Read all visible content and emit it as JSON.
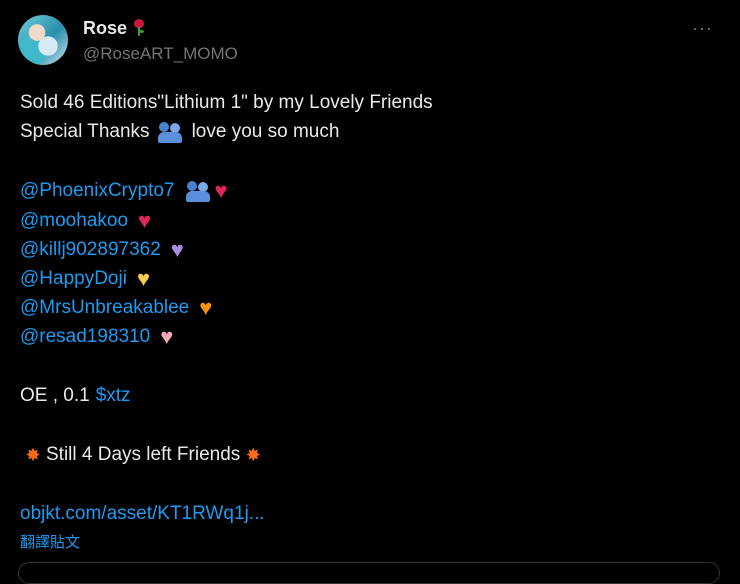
{
  "tweet": {
    "author_name": "Rose",
    "author_handle": "@RoseART_MOMO",
    "more_icon": "more-horizontal-icon",
    "line1": "Sold 46 Editions\"Lithium 1\" by my Lovely Friends",
    "line2_before": "Special Thanks",
    "line2_after": "love you so much",
    "mentions": [
      {
        "handle": "@PhoenixCrypto7",
        "icon": "people-hugging + sparkling-heart"
      },
      {
        "handle": "@moohakoo",
        "icon": "red-heart",
        "color": "#e0245e"
      },
      {
        "handle": "@killj902897362",
        "icon": "purple-heart",
        "color": "#a98ee6"
      },
      {
        "handle": "@HappyDoji",
        "icon": "yellow-heart",
        "color": "#ffcc4d"
      },
      {
        "handle": "@MrsUnbreakablee",
        "icon": "orange-heart",
        "color": "#f4900c"
      },
      {
        "handle": "@resad198310",
        "icon": "pink-heart",
        "color": "#f4a7b9"
      }
    ],
    "price_text": "OE , 0.1",
    "price_cashtag": "$xtz",
    "countdown": "Still 4 Days left Friends",
    "link": "objkt.com/asset/KT1RWq1j...",
    "translate_label": "翻譯貼文"
  },
  "colors": {
    "background": "#000000",
    "text": "#e7e9ea",
    "secondary": "#71767b",
    "link": "#1d9bf0"
  }
}
